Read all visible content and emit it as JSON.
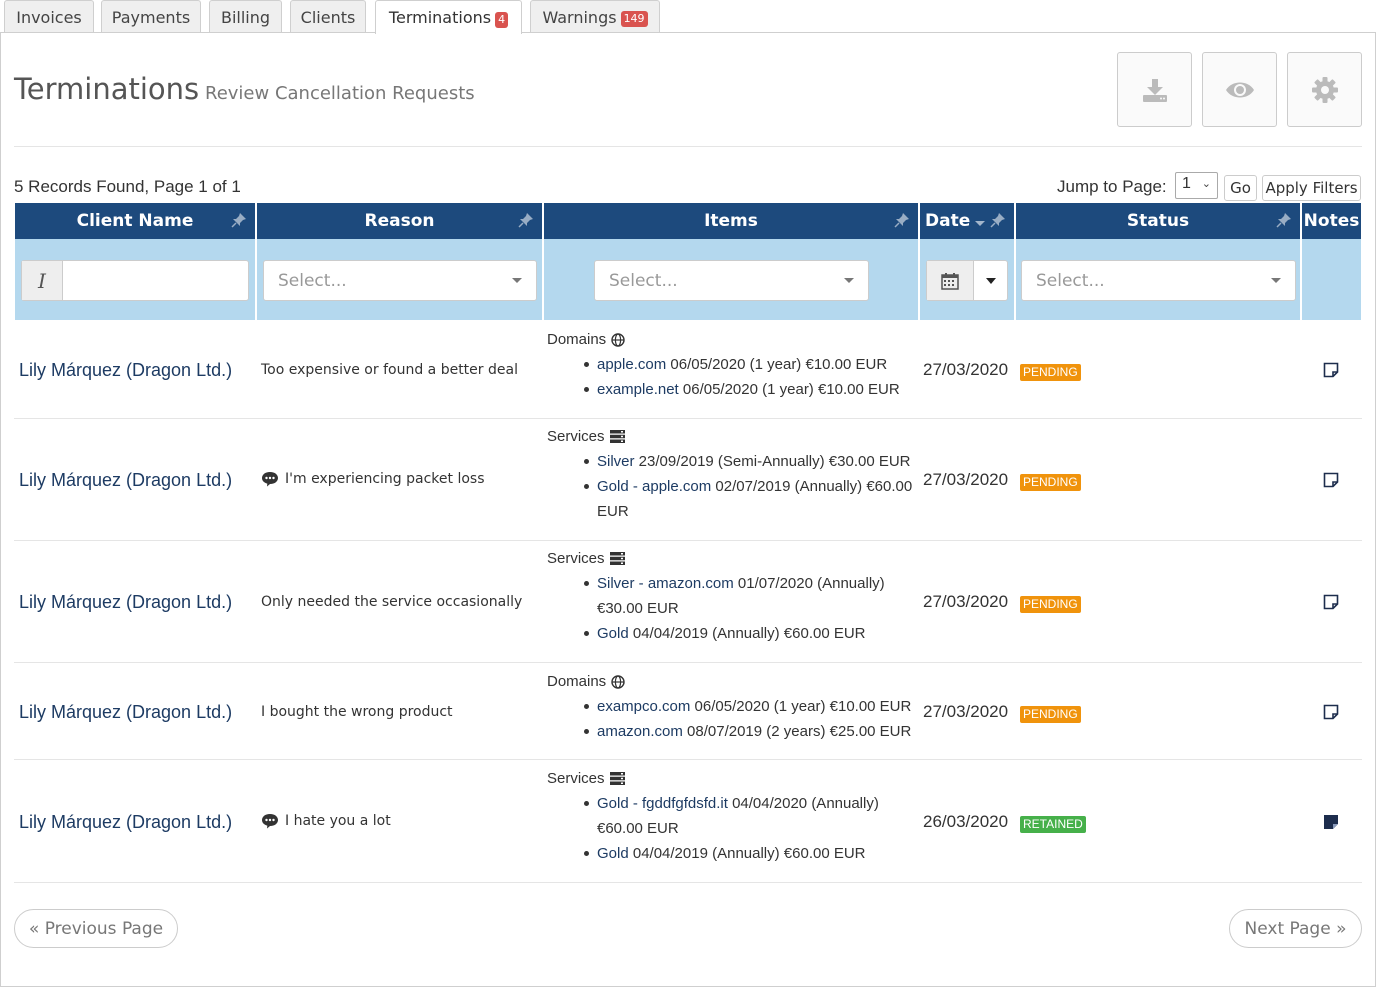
{
  "tabs": [
    {
      "label": "Invoices"
    },
    {
      "label": "Payments"
    },
    {
      "label": "Billing"
    },
    {
      "label": "Clients"
    },
    {
      "label": "Terminations",
      "badge": "4"
    },
    {
      "label": "Warnings",
      "badge": "149"
    }
  ],
  "header": {
    "title": "Terminations",
    "subtitle": "Review Cancellation Requests"
  },
  "toolbar": {
    "icons": [
      "download-icon",
      "eye-icon",
      "gear-icon"
    ]
  },
  "summary": {
    "records_text": "5 Records Found, Page 1 of 1",
    "jump_label": "Jump to Page:",
    "jump_value": "1",
    "go_label": "Go",
    "apply_filters_label": "Apply Filters"
  },
  "columns": {
    "client": "Client Name",
    "reason": "Reason",
    "items": "Items",
    "date": "Date",
    "status": "Status",
    "notes": "Notes"
  },
  "filters": {
    "client_prefix": "I",
    "reason_placeholder": "Select...",
    "items_placeholder": "Select...",
    "status_placeholder": "Select..."
  },
  "rows": [
    {
      "client": "Lily Márquez (Dragon Ltd.)",
      "reason": "Too expensive or found a better deal",
      "reason_icon": false,
      "category": "Domains",
      "lines": [
        {
          "link": "apple.com",
          "rest": " 06/05/2020 (1 year) €10.00 EUR"
        },
        {
          "link": "example.net",
          "rest": " 06/05/2020 (1 year) €10.00 EUR"
        }
      ],
      "date": "27/03/2020",
      "status": "PENDING"
    },
    {
      "client": "Lily Márquez (Dragon Ltd.)",
      "reason": "I'm experiencing packet loss",
      "reason_icon": true,
      "category": "Services",
      "lines": [
        {
          "link": "Silver",
          "rest": " 23/09/2019 (Semi-Annually) €30.00 EUR"
        },
        {
          "link": "Gold - apple.com",
          "rest": " 02/07/2019 (Annually) €60.00",
          "cont": "EUR"
        }
      ],
      "date": "27/03/2020",
      "status": "PENDING"
    },
    {
      "client": "Lily Márquez (Dragon Ltd.)",
      "reason": "Only needed the service occasionally",
      "reason_icon": false,
      "category": "Services",
      "lines": [
        {
          "link": "Silver - amazon.com",
          "rest": " 01/07/2020 (Annually)",
          "cont": "€30.00 EUR"
        },
        {
          "link": "Gold",
          "rest": " 04/04/2019 (Annually) €60.00 EUR"
        }
      ],
      "date": "27/03/2020",
      "status": "PENDING"
    },
    {
      "client": "Lily Márquez (Dragon Ltd.)",
      "reason": "I bought the wrong product",
      "reason_icon": false,
      "category": "Domains",
      "lines": [
        {
          "link": "exampco.com",
          "rest": " 06/05/2020 (1 year) €10.00 EUR"
        },
        {
          "link": "amazon.com",
          "rest": " 08/07/2019 (2 years) €25.00 EUR"
        }
      ],
      "date": "27/03/2020",
      "status": "PENDING"
    },
    {
      "client": "Lily Márquez (Dragon Ltd.)",
      "reason": "I hate you a lot",
      "reason_icon": true,
      "category": "Services",
      "lines": [
        {
          "link": "Gold - fgddfgfdsfd.it",
          "rest": " 04/04/2020 (Annually)",
          "cont": "€60.00 EUR"
        },
        {
          "link": "Gold",
          "rest": " 04/04/2019 (Annually) €60.00 EUR"
        }
      ],
      "date": "26/03/2020",
      "status": "RETAINED"
    }
  ],
  "pagination": {
    "prev": "« Previous Page",
    "next": "Next Page »"
  },
  "colors": {
    "header_bg": "#1d4a7d",
    "filter_bg": "#b4d8ee",
    "pending": "#f0930c",
    "retained": "#46b04a",
    "badge": "#d9534f"
  }
}
